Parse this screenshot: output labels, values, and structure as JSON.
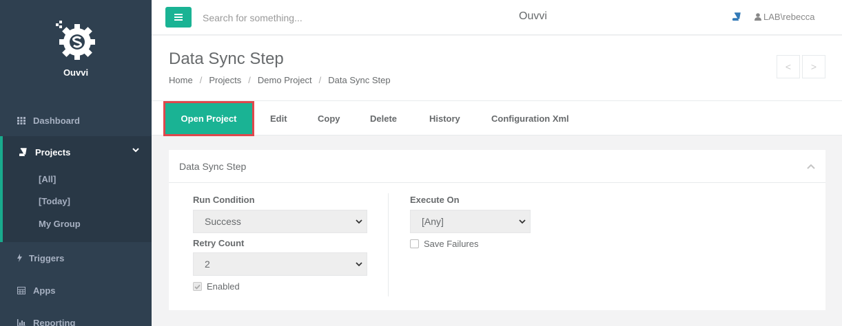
{
  "app": {
    "name": "Ouvvi"
  },
  "sidebar": {
    "logo_text": "Ouvvi",
    "items": [
      {
        "label": "Dashboard",
        "icon": "grid-icon"
      },
      {
        "label": "Projects",
        "icon": "book-icon"
      },
      {
        "label": "Triggers",
        "icon": "bolt-icon"
      },
      {
        "label": "Apps",
        "icon": "table-icon"
      },
      {
        "label": "Reporting",
        "icon": "bar-chart-icon"
      }
    ],
    "project_subitems": [
      "[All]",
      "[Today]",
      "My Group"
    ]
  },
  "topbar": {
    "search_placeholder": "Search for something...",
    "title": "Ouvvi",
    "user": "LAB\\rebecca"
  },
  "heading": {
    "title": "Data Sync Step",
    "breadcrumb": [
      "Home",
      "Projects",
      "Demo Project",
      "Data Sync Step"
    ],
    "prev": "<",
    "next": ">"
  },
  "tabs": {
    "primary": "Open Project",
    "items": [
      "Edit",
      "Copy",
      "Delete",
      "History",
      "Configuration Xml"
    ]
  },
  "panel": {
    "title": "Data Sync Step",
    "run_condition": {
      "label": "Run Condition",
      "value": "Success"
    },
    "retry_count": {
      "label": "Retry Count",
      "value": "2"
    },
    "enabled": {
      "label": "Enabled",
      "checked": true
    },
    "execute_on": {
      "label": "Execute On",
      "value": "[Any]"
    },
    "save_failures": {
      "label": "Save Failures",
      "checked": false
    }
  },
  "colors": {
    "accent": "#1ab394",
    "sidebar": "#2f4050",
    "highlight_border": "#e0474c"
  }
}
